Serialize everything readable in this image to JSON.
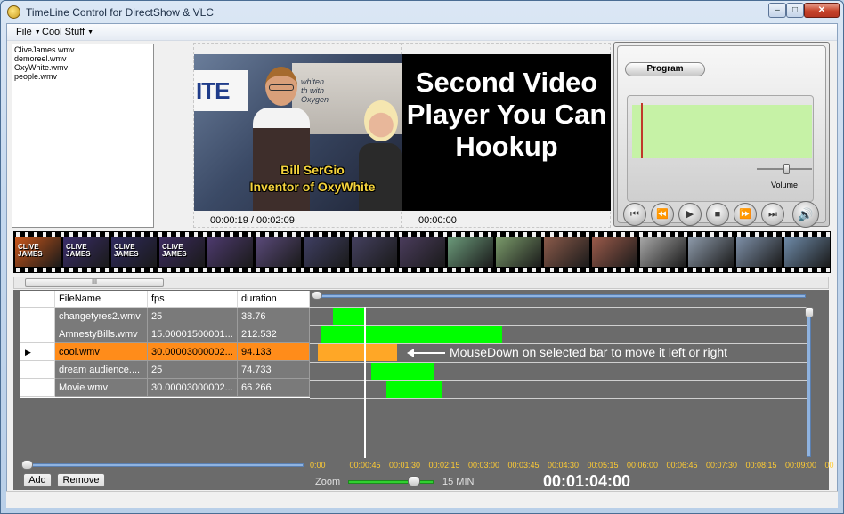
{
  "window": {
    "title": "TimeLine Control for DirectShow & VLC",
    "minimize_glyph": "–",
    "maximize_glyph": "□",
    "close_glyph": "✕"
  },
  "menu": {
    "items": [
      {
        "label": "File"
      },
      {
        "label": "Cool Stuff"
      }
    ]
  },
  "file_list": {
    "items": [
      "CliveJames.wmv",
      "demoreel.wmv",
      "OxyWhite.wmv",
      "people.wmv"
    ]
  },
  "player1": {
    "time": "00:00:19 / 00:02:09",
    "banner_text": "ITE",
    "board_text": "whiten\nth with\nOxygen",
    "caption_line1": "Bill SerGio",
    "caption_line2": "Inventor of OxyWhite"
  },
  "player2": {
    "time": "00:00:00",
    "overlay_text": "Second Video Player You Can Hookup"
  },
  "program_panel": {
    "tab_label": "Program",
    "volume_label": "Volume",
    "volume_level": 0.55,
    "position_fraction": 0.05,
    "buttons": [
      {
        "name": "skip-back-icon",
        "glyph": "⏮"
      },
      {
        "name": "rewind-icon",
        "glyph": "⏪"
      },
      {
        "name": "play-icon",
        "glyph": "▶"
      },
      {
        "name": "stop-icon",
        "glyph": "■"
      },
      {
        "name": "fast-forward-icon",
        "glyph": "⏩"
      },
      {
        "name": "skip-forward-icon",
        "glyph": "⏭"
      },
      {
        "name": "speaker-icon",
        "glyph": "🔊"
      }
    ]
  },
  "filmstrip": {
    "frames": [
      {
        "label": "CLIVE\nJAMES",
        "color": "#c8561b"
      },
      {
        "label": "CLIVE\nJAMES",
        "color": "#3a2d6a"
      },
      {
        "label": "CLIVE\nJAMES",
        "color": "#2f2a5e"
      },
      {
        "label": "CLIVE\nJAMES",
        "color": "#3c2b60"
      },
      {
        "label": "",
        "color": "#4d3a6e"
      },
      {
        "label": "",
        "color": "#5a4a7a"
      },
      {
        "label": "",
        "color": "#3f3f63"
      },
      {
        "label": "",
        "color": "#44405f"
      },
      {
        "label": "",
        "color": "#4a3c5c"
      },
      {
        "label": "",
        "color": "#6b9a7a"
      },
      {
        "label": "",
        "color": "#7a9a6a"
      },
      {
        "label": "",
        "color": "#8a5a4a"
      },
      {
        "label": "",
        "color": "#9a5a4a"
      },
      {
        "label": "",
        "color": "#a7a7a7"
      },
      {
        "label": "",
        "color": "#8d9aaa"
      },
      {
        "label": "",
        "color": "#7d8fa7"
      },
      {
        "label": "",
        "color": "#6e8aa8"
      }
    ]
  },
  "scrollbar": {
    "thumb_glyph": "III"
  },
  "grid": {
    "columns": [
      "FileName",
      "fps",
      "duration"
    ],
    "selected_marker": "▶",
    "rows": [
      {
        "file": "changetyres2.wmv",
        "fps": "25",
        "duration": "38.76",
        "selected": false
      },
      {
        "file": "AmnestyBills.wmv",
        "fps": "15.00001500001...",
        "duration": "212.532",
        "selected": false
      },
      {
        "file": "cool.wmv",
        "fps": "30.00003000002...",
        "duration": "94.133",
        "selected": true
      },
      {
        "file": "dream audience....",
        "fps": "25",
        "duration": "74.733",
        "selected": false
      },
      {
        "file": "Movie.wmv",
        "fps": "30.00003000002...",
        "duration": "66.266",
        "selected": false
      }
    ]
  },
  "timeline": {
    "range_seconds": [
      0,
      585
    ],
    "playhead_seconds": 64,
    "bars": [
      {
        "start": 27,
        "duration": 38.76,
        "selected": false
      },
      {
        "start": 14,
        "duration": 212.532,
        "selected": false
      },
      {
        "start": 9,
        "duration": 94.133,
        "selected": true
      },
      {
        "start": 72,
        "duration": 74.733,
        "selected": false
      },
      {
        "start": 90,
        "duration": 66.266,
        "selected": false
      }
    ],
    "annotation": "MouseDown on selected bar to move it left or right",
    "ruler": [
      "0:00",
      "00:00:45",
      "00:01:30",
      "00:02:15",
      "00:03:00",
      "00:03:45",
      "00:04:30",
      "00:05:15",
      "00:06:00",
      "00:06:45",
      "00:07:30",
      "00:08:15",
      "00:09:00",
      "00"
    ]
  },
  "controls": {
    "add_label": "Add",
    "remove_label": "Remove",
    "zoom_label": "Zoom",
    "zoom_value": "15 MIN",
    "zoom_level": 0.7,
    "current_time": "00:01:04:00"
  }
}
